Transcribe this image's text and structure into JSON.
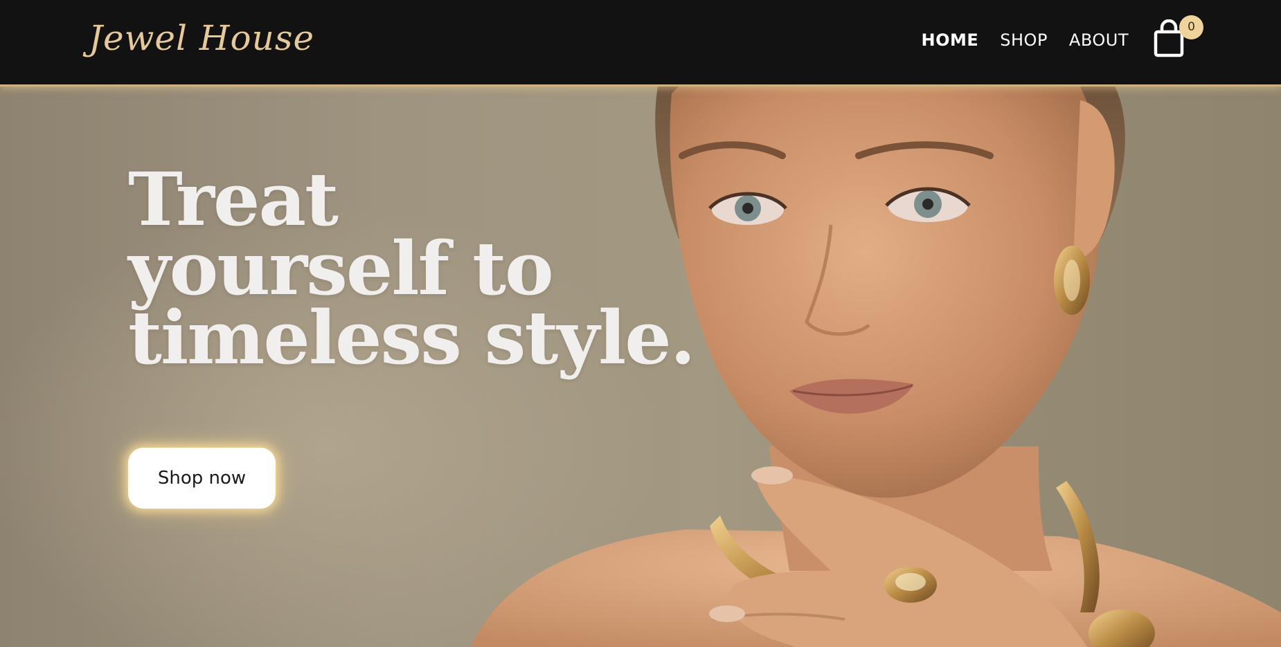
{
  "brand": {
    "name": "Jewel House",
    "logo_color": "#e5c99a"
  },
  "nav": {
    "items": [
      {
        "label": "HOME",
        "active": true
      },
      {
        "label": "SHOP",
        "active": false
      },
      {
        "label": "ABOUT",
        "active": false
      }
    ]
  },
  "cart": {
    "count": "0",
    "icon": "shopping-bag-icon",
    "badge_color": "#f0d39a"
  },
  "hero": {
    "headline_lines": [
      "Treat",
      "yourself to",
      "timeless style."
    ],
    "cta_label": "Shop now",
    "image": "woman-wearing-gold-jewelry-photo"
  },
  "colors": {
    "header_bg": "#121212",
    "accent_gold": "#cdb182",
    "headline_text": "#f1eeee"
  }
}
